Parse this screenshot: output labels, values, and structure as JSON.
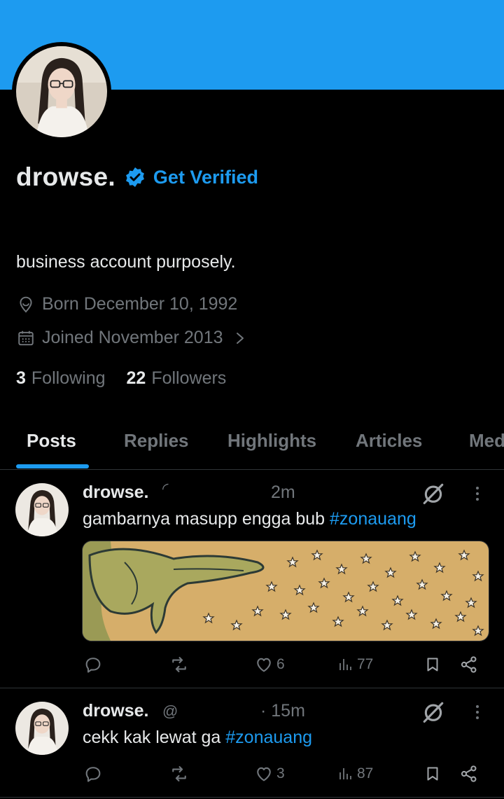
{
  "profile": {
    "display_name": "drowse.",
    "get_verified_label": "Get Verified",
    "bio": "business account purposely.",
    "born": "Born December 10, 1992",
    "joined": "Joined November 2013",
    "following_count": "3",
    "following_label": "Following",
    "followers_count": "22",
    "followers_label": "Followers"
  },
  "tabs": [
    {
      "label": "Posts",
      "active": true
    },
    {
      "label": "Replies"
    },
    {
      "label": "Highlights"
    },
    {
      "label": "Articles"
    },
    {
      "label": "Med"
    }
  ],
  "posts": [
    {
      "name": "drowse.",
      "handle": "◜",
      "time": "2m",
      "text": "gambarnya masupp engga bub ",
      "hashtag": "#zonauang",
      "has_media": true,
      "likes": "6",
      "views": "77"
    },
    {
      "name": "drowse.",
      "handle": "@",
      "time": "· 15m",
      "text": "cekk kak lewat ga ",
      "hashtag": "#zonauang",
      "has_media": false,
      "likes": "3",
      "views": "87"
    }
  ],
  "colors": {
    "accent": "#1d9bf0",
    "background": "#000000",
    "text_primary": "#e7e9ea",
    "text_secondary": "#71767b"
  },
  "icons": [
    "verified-badge-icon",
    "location-pin-icon",
    "calendar-icon",
    "chevron-right-icon",
    "grok-icon",
    "more-options-icon",
    "reply-icon",
    "repost-icon",
    "like-icon",
    "views-icon",
    "bookmark-icon",
    "share-icon"
  ]
}
